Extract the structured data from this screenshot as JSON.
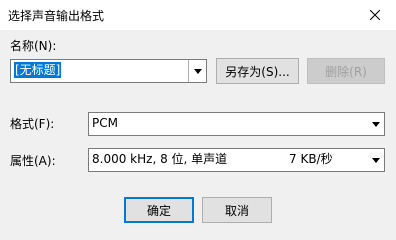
{
  "window": {
    "title": "选择声音输出格式"
  },
  "name_section": {
    "label": "名称(N):",
    "value": "[无标题]",
    "save_as_label": "另存为(S)...",
    "delete_label": "删除(R)"
  },
  "format_section": {
    "label": "格式(F):",
    "value": "PCM"
  },
  "attributes_section": {
    "label": "属性(A):",
    "value_left": "8.000 kHz, 8 位, 单声道",
    "value_right": "7 KB/秒"
  },
  "buttons": {
    "ok_label": "确定",
    "cancel_label": "取消"
  },
  "colors": {
    "accent": "#0078d7",
    "client_bg": "#f0f0f0"
  }
}
